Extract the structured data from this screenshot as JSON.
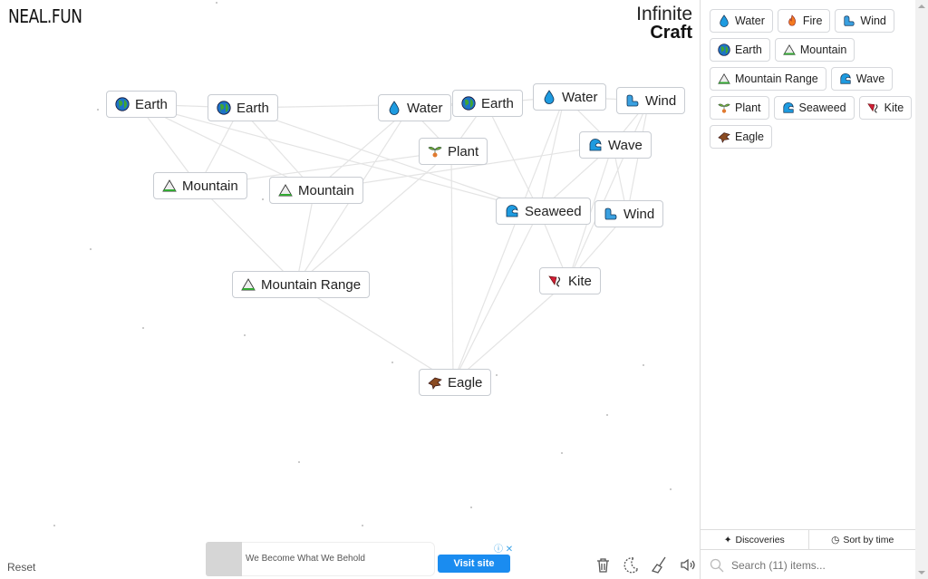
{
  "header": {
    "logo": "NEAL.FUN",
    "title_line1": "Infinite",
    "title_line2": "Craft"
  },
  "canvas": {
    "nodes": [
      {
        "label": "Earth",
        "icon": "earth-icon"
      },
      {
        "label": "Earth",
        "icon": "earth-icon"
      },
      {
        "label": "Water",
        "icon": "water-drop-icon"
      },
      {
        "label": "Earth",
        "icon": "earth-icon"
      },
      {
        "label": "Water",
        "icon": "water-drop-icon"
      },
      {
        "label": "Wind",
        "icon": "wind-icon"
      },
      {
        "label": "Plant",
        "icon": "plant-icon"
      },
      {
        "label": "Wave",
        "icon": "wave-icon"
      },
      {
        "label": "Mountain",
        "icon": "mountain-icon"
      },
      {
        "label": "Mountain",
        "icon": "mountain-icon"
      },
      {
        "label": "Seaweed",
        "icon": "wave-icon"
      },
      {
        "label": "Wind",
        "icon": "wind-icon"
      },
      {
        "label": "Mountain Range",
        "icon": "mountain-icon"
      },
      {
        "label": "Kite",
        "icon": "kite-icon"
      },
      {
        "label": "Eagle",
        "icon": "eagle-icon"
      }
    ],
    "reset_label": "Reset",
    "tools": [
      "trash-icon",
      "dark-mode-icon",
      "broom-icon",
      "sound-icon"
    ]
  },
  "ad": {
    "text": "We Become What We Behold",
    "button": "Visit site"
  },
  "sidebar": {
    "items": [
      {
        "label": "Water",
        "icon": "water-drop-icon"
      },
      {
        "label": "Fire",
        "icon": "fire-icon"
      },
      {
        "label": "Wind",
        "icon": "wind-icon"
      },
      {
        "label": "Earth",
        "icon": "earth-icon"
      },
      {
        "label": "Mountain",
        "icon": "mountain-icon"
      },
      {
        "label": "Mountain Range",
        "icon": "mountain-icon"
      },
      {
        "label": "Wave",
        "icon": "wave-icon"
      },
      {
        "label": "Plant",
        "icon": "plant-icon"
      },
      {
        "label": "Seaweed",
        "icon": "wave-icon"
      },
      {
        "label": "Kite",
        "icon": "kite-icon"
      },
      {
        "label": "Eagle",
        "icon": "eagle-icon"
      }
    ],
    "tabs": {
      "discoveries": "Discoveries",
      "sort": "Sort by time"
    },
    "search_placeholder": "Search (11) items..."
  }
}
